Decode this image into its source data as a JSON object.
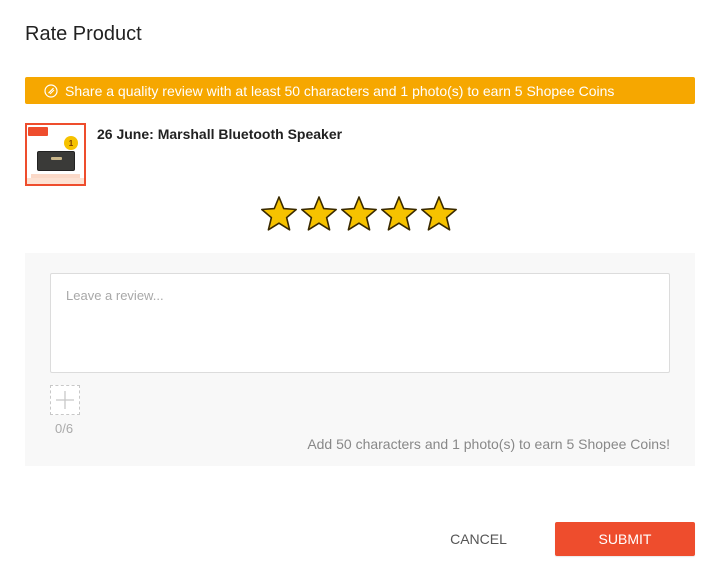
{
  "dialog": {
    "title": "Rate Product"
  },
  "banner": {
    "icon": "coin-icon",
    "text": "Share a quality review with at least 50 characters and 1 photo(s) to earn 5 Shopee Coins",
    "color": "#f6a700"
  },
  "product": {
    "name": "26 June: Marshall Bluetooth Speaker",
    "thumbnail_badge": "1"
  },
  "rating": {
    "value": 5,
    "max": 5,
    "star_color": "#f6c200"
  },
  "review": {
    "placeholder": "Leave a review...",
    "value": "",
    "photo_count": "0/6",
    "hint": "Add 50 characters and 1 photo(s) to earn 5 Shopee Coins!"
  },
  "actions": {
    "cancel_label": "CANCEL",
    "submit_label": "SUBMIT",
    "accent_color": "#ee4d2d"
  }
}
